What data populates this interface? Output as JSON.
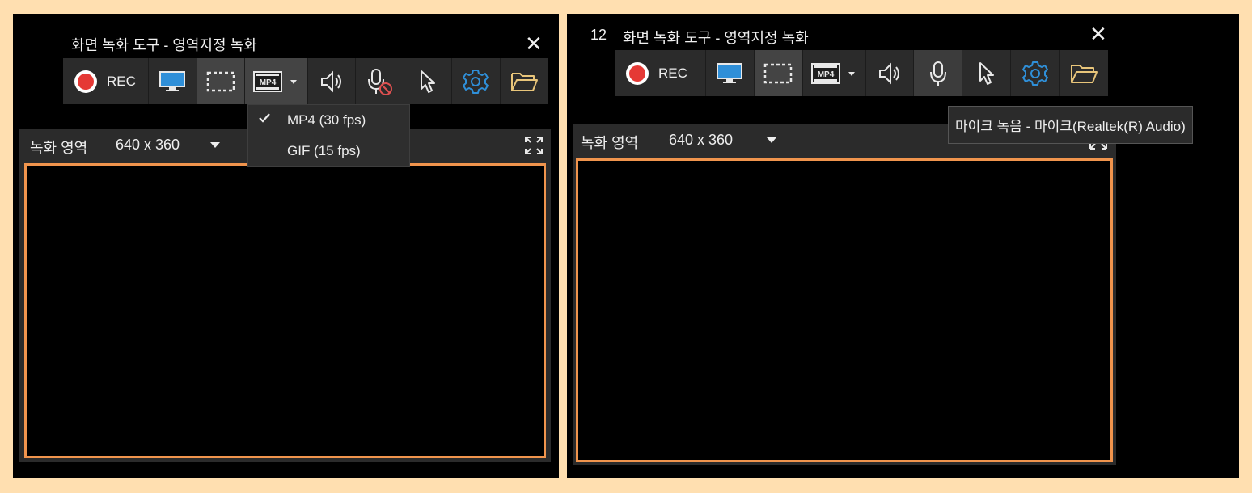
{
  "left": {
    "title": "화면 녹화 도구 - 영역지정 녹화",
    "close": "✕",
    "toolbar": {
      "rec_label": "REC",
      "format_icon_text": "MP4"
    },
    "format_menu": {
      "items": [
        {
          "label": "MP4 (30 fps)",
          "checked": true
        },
        {
          "label": "GIF (15 fps)",
          "checked": false
        }
      ]
    },
    "area": {
      "label": "녹화 영역",
      "size": "640 x 360"
    }
  },
  "right": {
    "counter": "12",
    "title": "화면 녹화 도구 - 영역지정 녹화",
    "close": "✕",
    "toolbar": {
      "rec_label": "REC",
      "format_icon_text": "MP4"
    },
    "tooltip": "마이크 녹음 - 마이크(Realtek(R) Audio)",
    "area": {
      "label": "녹화 영역",
      "size": "640 x 360"
    }
  },
  "colors": {
    "background": "#ffdfb0",
    "record_red": "#e53935",
    "accent_blue": "#2f8fd8",
    "folder_yellow": "#e8c57a",
    "frame_orange": "#f0944d",
    "mic_disabled_red": "#e05050"
  }
}
